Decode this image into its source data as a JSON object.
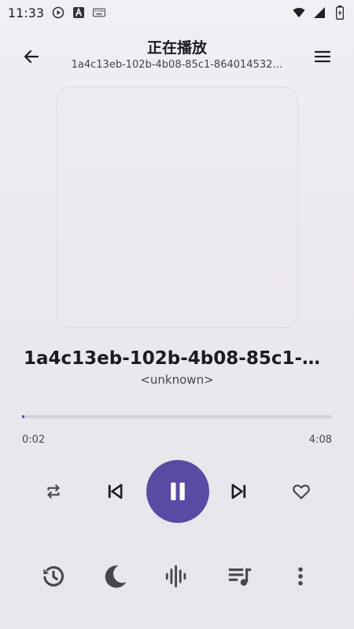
{
  "status_bar": {
    "time": "11:33",
    "icons": [
      "play-circle-icon",
      "font-a-icon",
      "keyboard-icon",
      "wifi-icon",
      "signal-icon",
      "battery-icon"
    ]
  },
  "header": {
    "title": "正在播放",
    "subtitle": "1a4c13eb-102b-4b08-85c1-864014532…"
  },
  "song": {
    "title": "1a4c13eb-102b-4b08-85c1-8…",
    "artist": "<unknown>"
  },
  "progress": {
    "current": "0:02",
    "duration": "4:08",
    "fraction": 0.008
  },
  "controls": {
    "repeat": "repeat-icon",
    "previous": "skip-previous-icon",
    "play_pause": "pause-icon",
    "next": "skip-next-icon",
    "favorite": "heart-outline-icon"
  },
  "bottom_actions": [
    "history-icon",
    "sleep-timer-moon-icon",
    "equalizer-waveform-icon",
    "queue-music-icon",
    "more-vert-icon"
  ],
  "colors": {
    "accent": "#5b4aa3",
    "icon": "#49454f"
  }
}
